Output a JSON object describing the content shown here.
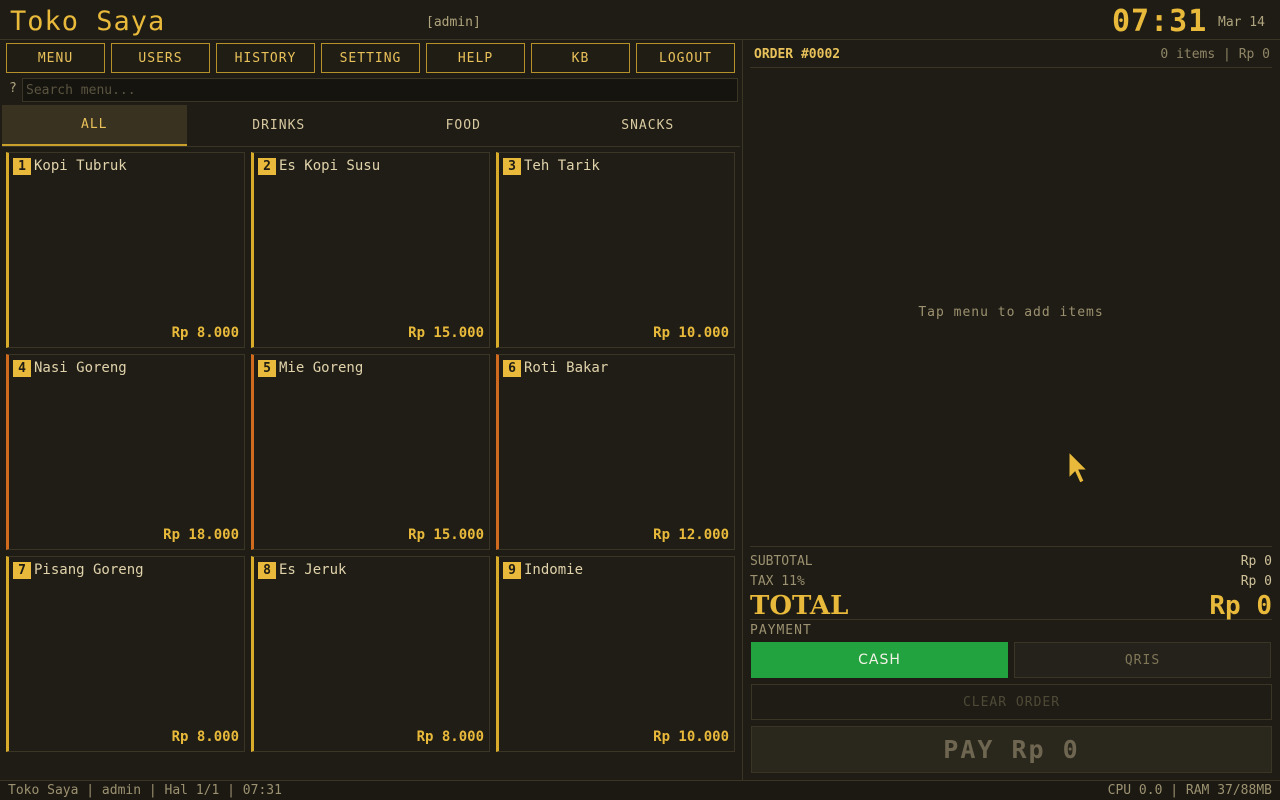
{
  "header": {
    "title": "Toko Saya",
    "user_tag": "[admin]",
    "clock": "07:31",
    "date": "Mar 14"
  },
  "nav": [
    "MENU",
    "USERS",
    "HISTORY",
    "SETTING",
    "HELP",
    "KB",
    "LOGOUT"
  ],
  "search": {
    "icon_glyph": "?",
    "placeholder": "Search menu...",
    "value": ""
  },
  "categories": [
    {
      "label": "ALL",
      "active": true
    },
    {
      "label": "DRINKS",
      "active": false
    },
    {
      "label": "FOOD",
      "active": false
    },
    {
      "label": "SNACKS",
      "active": false
    }
  ],
  "menu_items": [
    {
      "num": "1",
      "name": "Kopi Tubruk",
      "price": "Rp 8.000",
      "accent": "#d8ac2a"
    },
    {
      "num": "2",
      "name": "Es Kopi Susu",
      "price": "Rp 15.000",
      "accent": "#d8ac2a"
    },
    {
      "num": "3",
      "name": "Teh Tarik",
      "price": "Rp 10.000",
      "accent": "#d8ac2a"
    },
    {
      "num": "4",
      "name": "Nasi Goreng",
      "price": "Rp 18.000",
      "accent": "#d06a1e"
    },
    {
      "num": "5",
      "name": "Mie Goreng",
      "price": "Rp 15.000",
      "accent": "#d06a1e"
    },
    {
      "num": "6",
      "name": "Roti Bakar",
      "price": "Rp 12.000",
      "accent": "#d06a1e"
    },
    {
      "num": "7",
      "name": "Pisang Goreng",
      "price": "Rp 8.000",
      "accent": "#d8ac2a"
    },
    {
      "num": "8",
      "name": "Es Jeruk",
      "price": "Rp 8.000",
      "accent": "#d8ac2a"
    },
    {
      "num": "9",
      "name": "Indomie",
      "price": "Rp 10.000",
      "accent": "#d8ac2a"
    }
  ],
  "order": {
    "title": "ORDER #0002",
    "summary": "0 items | Rp 0",
    "empty_message": "Tap menu to add items",
    "subtotal_label": "SUBTOTAL",
    "subtotal_value": "Rp 0",
    "tax_label": "TAX 11%",
    "tax_value": "Rp 0",
    "total_label": "TOTAL",
    "total_value": "Rp 0",
    "payment_label": "PAYMENT",
    "cash_label": "CASH",
    "qris_label": "QRIS",
    "clear_label": "CLEAR ORDER",
    "pay_label": "PAY Rp 0"
  },
  "status": {
    "left": "Toko Saya | admin | Hal 1/1 | 07:31",
    "right": "CPU 0.0 | RAM 37/88MB"
  },
  "colors": {
    "accent": "#e8b93a",
    "drinks_accent": "#d8ac2a",
    "food_accent": "#d06a1e",
    "cash_green": "#22a33f",
    "background": "#1e1c14"
  }
}
